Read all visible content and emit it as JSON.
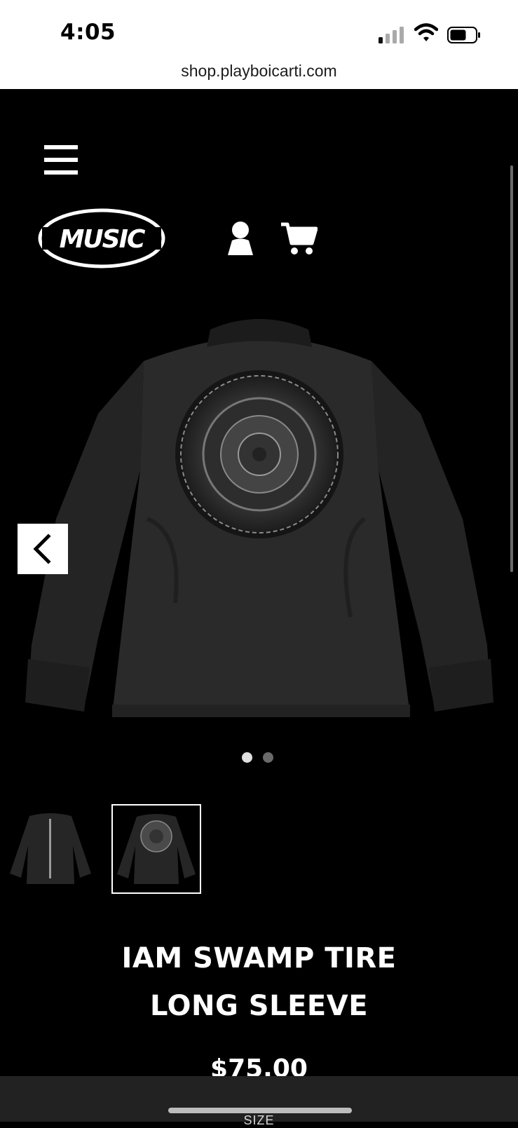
{
  "status_bar": {
    "time": "4:05"
  },
  "browser": {
    "url": "shop.playboicarti.com"
  },
  "header": {
    "logo_text": "MUSIC"
  },
  "product": {
    "title_line1": "IAM SWAMP TIRE",
    "title_line2": "LONG SLEEVE",
    "price": "$75.00",
    "size_label": "SIZE"
  },
  "gallery": {
    "total_images": 2,
    "active_index": 2
  },
  "colors": {
    "background": "#000000",
    "text": "#ffffff",
    "shirt": "#262626"
  }
}
